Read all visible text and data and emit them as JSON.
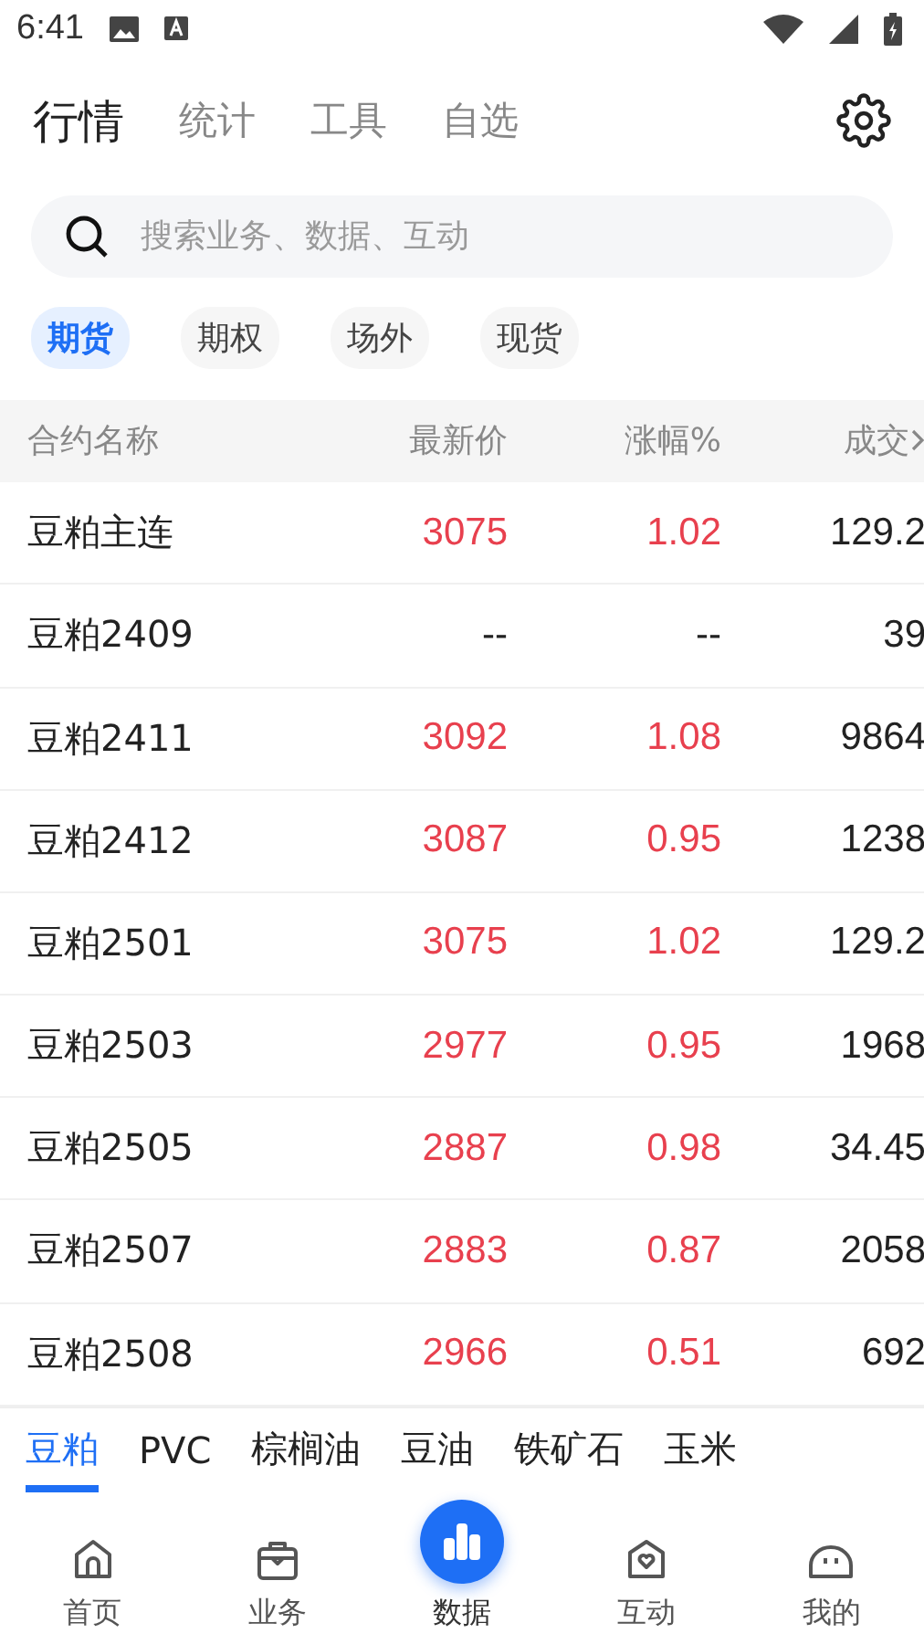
{
  "status_bar": {
    "time": "6:41"
  },
  "top_tabs": [
    {
      "label": "行情",
      "selected": true
    },
    {
      "label": "统计",
      "selected": false
    },
    {
      "label": "工具",
      "selected": false
    },
    {
      "label": "自选",
      "selected": false
    }
  ],
  "search": {
    "placeholder": "搜索业务、数据、互动"
  },
  "market_chips": [
    {
      "label": "期货",
      "selected": true
    },
    {
      "label": "期权",
      "selected": false
    },
    {
      "label": "场外",
      "selected": false
    },
    {
      "label": "现货",
      "selected": false
    }
  ],
  "table": {
    "columns": [
      "合约名称",
      "最新价",
      "涨幅%",
      "成交"
    ],
    "rows": [
      {
        "name": "豆粕主连",
        "price": "3075",
        "change": "1.02",
        "volume": "129.2",
        "color": "#e8404e"
      },
      {
        "name": "豆粕2409",
        "price": "--",
        "change": "--",
        "volume": "39",
        "color": "#222222"
      },
      {
        "name": "豆粕2411",
        "price": "3092",
        "change": "1.08",
        "volume": "9864",
        "color": "#e8404e"
      },
      {
        "name": "豆粕2412",
        "price": "3087",
        "change": "0.95",
        "volume": "1238",
        "color": "#e8404e"
      },
      {
        "name": "豆粕2501",
        "price": "3075",
        "change": "1.02",
        "volume": "129.2",
        "color": "#e8404e"
      },
      {
        "name": "豆粕2503",
        "price": "2977",
        "change": "0.95",
        "volume": "1968",
        "color": "#e8404e"
      },
      {
        "name": "豆粕2505",
        "price": "2887",
        "change": "0.98",
        "volume": "34.45",
        "color": "#e8404e"
      },
      {
        "name": "豆粕2507",
        "price": "2883",
        "change": "0.87",
        "volume": "2058",
        "color": "#e8404e"
      },
      {
        "name": "豆粕2508",
        "price": "2966",
        "change": "0.51",
        "volume": "692",
        "color": "#e8404e"
      }
    ]
  },
  "commodity_tabs": [
    {
      "label": "豆粕",
      "selected": true
    },
    {
      "label": "PVC",
      "selected": false
    },
    {
      "label": "棕榈油",
      "selected": false
    },
    {
      "label": "豆油",
      "selected": false
    },
    {
      "label": "铁矿石",
      "selected": false
    },
    {
      "label": "玉米",
      "selected": false
    }
  ],
  "bottom_nav": [
    {
      "label": "首页",
      "kind": "home",
      "selected": false
    },
    {
      "label": "业务",
      "kind": "bag",
      "selected": false
    },
    {
      "label": "数据",
      "kind": "chart",
      "selected": true
    },
    {
      "label": "互动",
      "kind": "heart",
      "selected": false
    },
    {
      "label": "我的",
      "kind": "face",
      "selected": false
    }
  ]
}
